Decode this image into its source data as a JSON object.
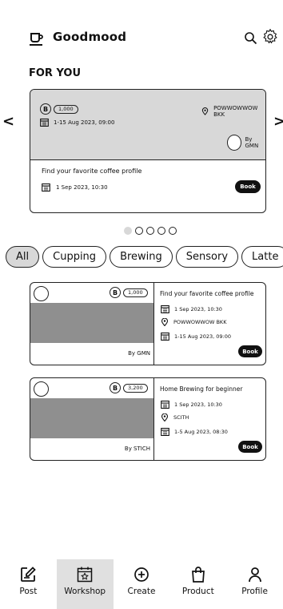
{
  "header": {
    "title": "Goodmood",
    "logo_icon": "coffee-cup-icon",
    "search_icon": "search-icon",
    "settings_icon": "gear-icon"
  },
  "section_title": "FOR YOU",
  "hero": {
    "coin_symbol": "B",
    "price": "1,000",
    "date_range": "1-15 Aug 2023, 09:00",
    "location": "POWWOWWOW BKK",
    "by": "By GMN",
    "title": "Find your favorite coffee profile",
    "date": "1 Sep 2023, 10:30",
    "book_label": "Book"
  },
  "carousel": {
    "left_arrow": "<",
    "right_arrow": ">",
    "pages": 5,
    "active_page": 1
  },
  "filters": [
    "All",
    "Cupping",
    "Brewing",
    "Sensory",
    "Latte"
  ],
  "cards": [
    {
      "coin_symbol": "B",
      "price": "1,000",
      "by": "By GMN",
      "title": "Find your favorite coffee profile",
      "date": "1 Sep 2023, 10:30",
      "location": "POWWOWWOW BKK",
      "date_range": "1-15 Aug 2023, 09:00",
      "book_label": "Book"
    },
    {
      "coin_symbol": "B",
      "price": "3,200",
      "by": "By STICH",
      "title": "Home Brewing for beginner",
      "date": "1 Sep 2023, 10:30",
      "location": "SCITH",
      "date_range": "1-5 Aug 2023, 08:30",
      "book_label": "Book"
    }
  ],
  "nav": [
    {
      "label": "Post",
      "icon": "edit-note-icon"
    },
    {
      "label": "Workshop",
      "icon": "calendar-star-icon",
      "active": true
    },
    {
      "label": "Create",
      "icon": "plus-circle-icon"
    },
    {
      "label": "Product",
      "icon": "shopping-bag-icon"
    },
    {
      "label": "Profile",
      "icon": "person-icon"
    }
  ]
}
